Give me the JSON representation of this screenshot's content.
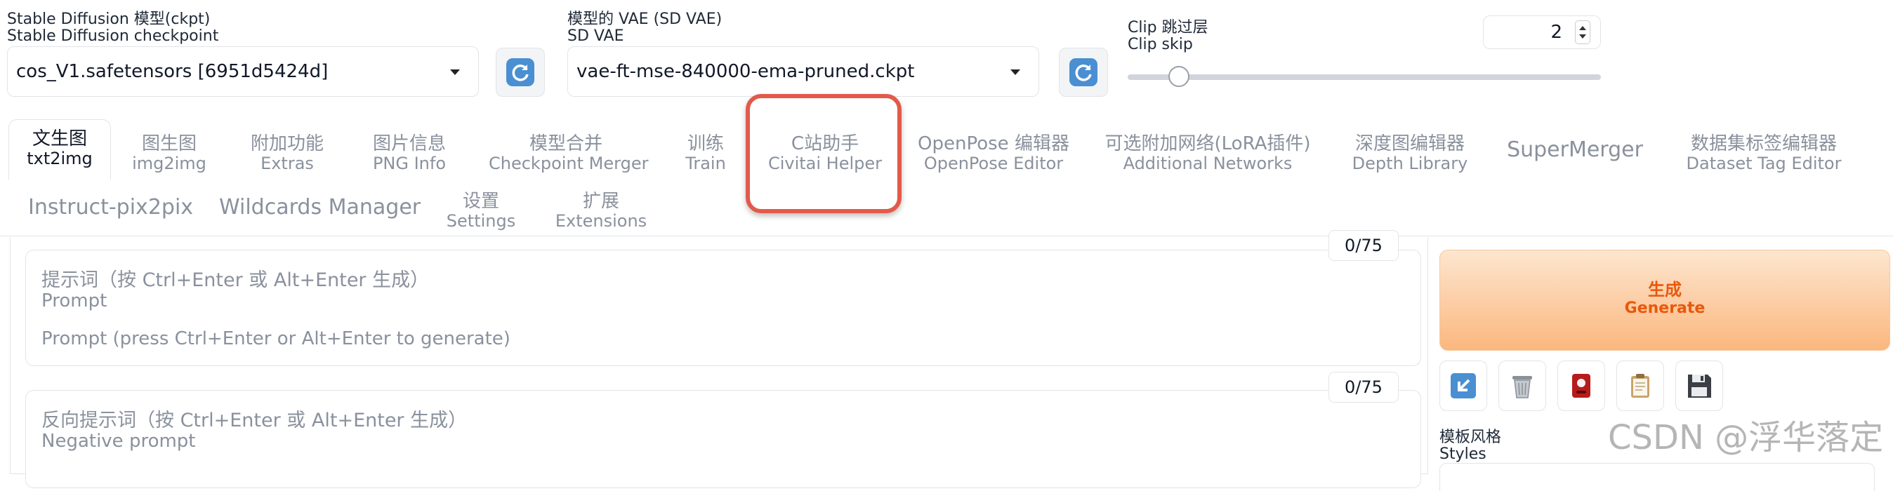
{
  "checkpoint": {
    "label_zh": "Stable Diffusion 模型(ckpt)",
    "label_en": "Stable Diffusion checkpoint",
    "value": "cos_V1.safetensors [6951d5424d]"
  },
  "vae": {
    "label_zh": "模型的 VAE (SD VAE)",
    "label_en": "SD VAE",
    "value": "vae-ft-mse-840000-ema-pruned.ckpt"
  },
  "clip_skip": {
    "label_zh": "Clip 跳过层",
    "label_en": "Clip skip",
    "value": "2",
    "slider_fraction": 0.0
  },
  "tabs_row1": [
    {
      "zh": "文生图",
      "en": "txt2img",
      "active": true
    },
    {
      "zh": "图生图",
      "en": "img2img"
    },
    {
      "zh": "附加功能",
      "en": "Extras"
    },
    {
      "zh": "图片信息",
      "en": "PNG Info"
    },
    {
      "zh": "模型合并",
      "en": "Checkpoint Merger"
    },
    {
      "zh": "训练",
      "en": "Train"
    },
    {
      "zh": "C站助手",
      "en": "Civitai Helper",
      "highlighted": true
    },
    {
      "zh": "OpenPose 编辑器",
      "en": "OpenPose Editor"
    },
    {
      "zh": "可选附加网络(LoRA插件)",
      "en": "Additional Networks"
    },
    {
      "zh": "深度图编辑器",
      "en": "Depth Library"
    },
    {
      "zh": "",
      "en": "SuperMerger"
    },
    {
      "zh": "数据集标签编辑器",
      "en": "Dataset Tag Editor"
    }
  ],
  "tabs_row2": [
    {
      "zh": "",
      "en": "Instruct-pix2pix"
    },
    {
      "zh": "",
      "en": "Wildcards Manager"
    },
    {
      "zh": "设置",
      "en": "Settings"
    },
    {
      "zh": "扩展",
      "en": "Extensions"
    }
  ],
  "prompt": {
    "counter": "0/75",
    "label_zh": "提示词（按 Ctrl+Enter 或 Alt+Enter 生成）",
    "label_en": "Prompt",
    "placeholder": "Prompt (press Ctrl+Enter or Alt+Enter to generate)"
  },
  "negative_prompt": {
    "counter": "0/75",
    "label_zh": "反向提示词（按 Ctrl+Enter 或 Alt+Enter 生成）",
    "label_en": "Negative prompt"
  },
  "generate": {
    "label_zh": "生成",
    "label_en": "Generate"
  },
  "tools": [
    {
      "icon": "arrow-icon"
    },
    {
      "icon": "trash-icon"
    },
    {
      "icon": "red-card-icon"
    },
    {
      "icon": "clipboard-icon"
    },
    {
      "icon": "save-icon"
    }
  ],
  "styles": {
    "label_zh": "模板风格",
    "label_en": "Styles"
  },
  "watermark": "CSDN @浮华落定",
  "colors": {
    "highlight_border": "#e25a4a",
    "generate_bg_top": "#fde3c8",
    "generate_bg_bottom": "#fbb47a",
    "generate_text": "#ea580c"
  }
}
